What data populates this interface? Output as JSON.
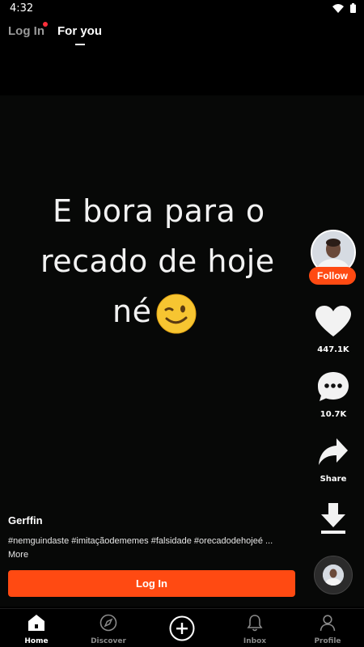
{
  "status_bar": {
    "time": "4:32"
  },
  "top_nav": {
    "login_tab": "Log In",
    "for_you_tab": "For you"
  },
  "video": {
    "caption_lines": [
      "E bora para o",
      "recado de hoje",
      "né"
    ]
  },
  "creator": {
    "follow_label": "Follow"
  },
  "actions": {
    "likes": "447.1K",
    "comments": "10.7K",
    "share_label": "Share"
  },
  "post": {
    "author": "Gerffin",
    "hashtags": "#nemguindaste #imitaçãodememes #falsidade #orecadodehojeé ...",
    "more_label": "More"
  },
  "login_button": "Log In",
  "bottom_nav": {
    "home": "Home",
    "discover": "Discover",
    "inbox": "Inbox",
    "profile": "Profile"
  },
  "colors": {
    "accent": "#ff4a12",
    "notification_dot": "#ff2f3a"
  }
}
